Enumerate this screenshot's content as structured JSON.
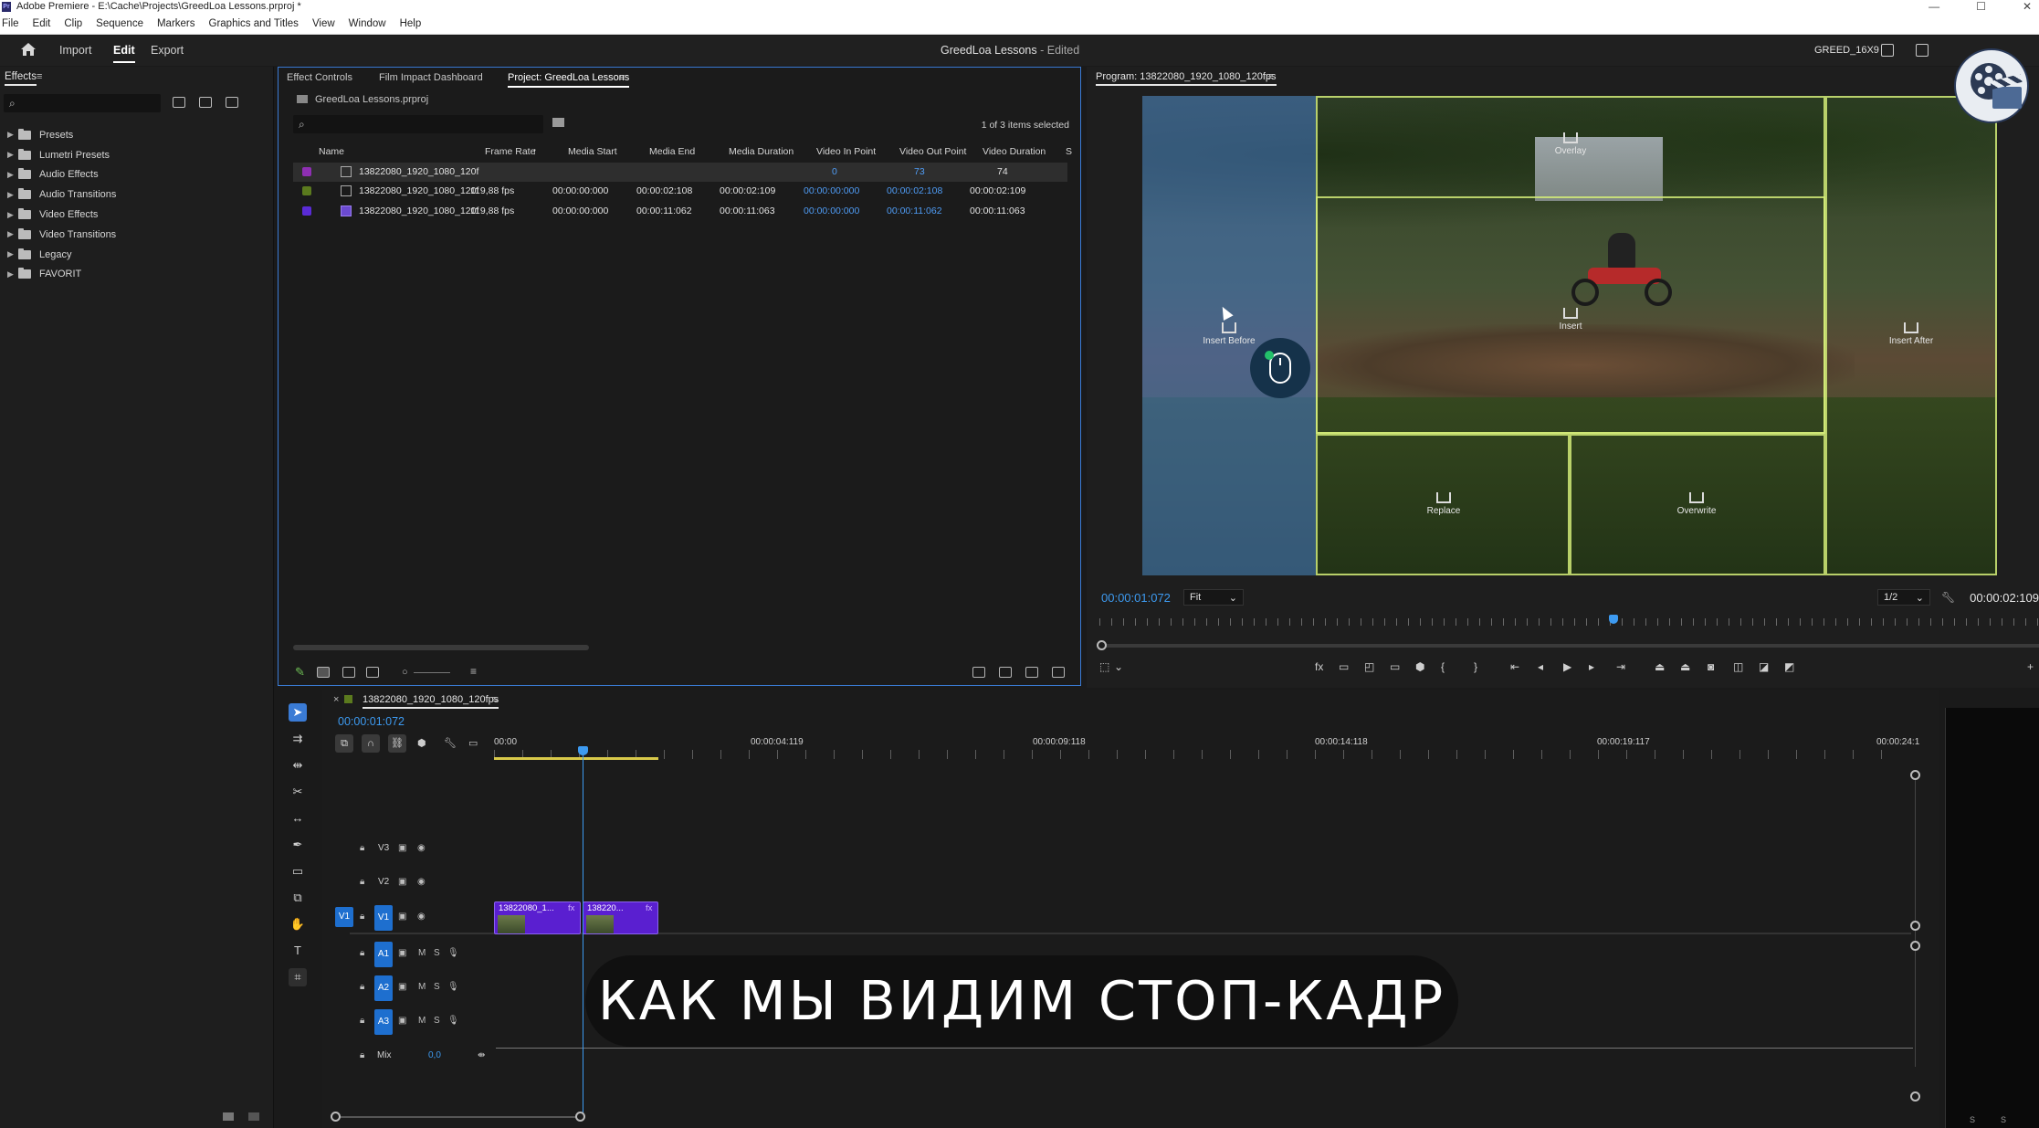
{
  "window": {
    "title": "Adobe Premiere - E:\\Cache\\Projects\\GreedLoa Lessons.prproj *",
    "logo_text": "Pr",
    "controls": [
      "—",
      "☐",
      "✕"
    ]
  },
  "menu": [
    "File",
    "Edit",
    "Clip",
    "Sequence",
    "Markers",
    "Graphics and Titles",
    "View",
    "Window",
    "Help"
  ],
  "header": {
    "tabs": [
      {
        "label": "Import",
        "active": false
      },
      {
        "label": "Edit",
        "active": true
      },
      {
        "label": "Export",
        "active": false
      }
    ],
    "project_name": "GreedLoa Lessons",
    "project_status": " - Edited",
    "workspace": "GREED_16X9"
  },
  "effects_panel": {
    "title": "Effects",
    "menu_icon": "≡",
    "search_placeholder": "",
    "items": [
      "Presets",
      "Lumetri Presets",
      "Audio Effects",
      "Audio Transitions",
      "Video Effects",
      "Video Transitions",
      "Legacy",
      "FAVORIT"
    ]
  },
  "project_panel": {
    "tabs": [
      {
        "label": "Effect Controls",
        "active": false
      },
      {
        "label": "Film Impact Dashboard",
        "active": false
      },
      {
        "label": "Project: GreedLoa Lessons",
        "active": true
      }
    ],
    "tab_menu_icon": "≡",
    "project_file": "GreedLoa Lessons.prproj",
    "search_placeholder": "",
    "selection_status": "1 of 3 items selected",
    "columns": [
      "Name",
      "Frame Rate",
      "Media Start",
      "Media End",
      "Media Duration",
      "Video In Point",
      "Video Out Point",
      "Video Duration",
      "S"
    ],
    "sort_indicator": "↑",
    "rows": [
      {
        "color": "#8e2fb3",
        "name": "13822080_1920_1080_120f",
        "frame_rate": "",
        "media_start": "",
        "media_end": "",
        "media_duration": "",
        "video_in": "0",
        "video_out": "73",
        "video_duration": "74",
        "highlighted": true
      },
      {
        "color": "#5b7a1e",
        "name": "13822080_1920_1080_120f",
        "frame_rate": "119,88 fps",
        "media_start": "00:00:00:000",
        "media_end": "00:00:02:108",
        "media_duration": "00:00:02:109",
        "video_in": "00:00:00:000",
        "video_out": "00:00:02:108",
        "video_duration": "00:00:02:109",
        "highlighted": false
      },
      {
        "color": "#5a2bd6",
        "name": "13822080_1920_1080_120f",
        "frame_rate": "119,88 fps",
        "media_start": "00:00:00:000",
        "media_end": "00:00:11:062",
        "media_duration": "00:00:11:063",
        "video_in": "00:00:00:000",
        "video_out": "00:00:11:062",
        "video_duration": "00:00:11:063",
        "highlighted": false
      }
    ]
  },
  "program_monitor": {
    "title": "Program: 13822080_1920_1080_120fps",
    "menu_icon": "≡",
    "timecode": "00:00:01:072",
    "zoom": "Fit",
    "resolution": "1/2",
    "duration": "00:00:02:109",
    "drop_zones": {
      "overlay": "Overlay",
      "insert_before": "Insert Before",
      "insert": "Insert",
      "insert_after": "Insert After",
      "replace": "Replace",
      "overwrite": "Overwrite"
    }
  },
  "timeline": {
    "sequence_name": "13822080_1920_1080_120fps",
    "menu_icon": "≡",
    "close_icon": "×",
    "timecode": "00:00:01:072",
    "ruler_labels": [
      "00:00",
      "00:00:04:119",
      "00:00:09:118",
      "00:00:14:118",
      "00:00:19:117",
      "00:00:24:1"
    ],
    "video_tracks": [
      {
        "name": "V3",
        "source": ""
      },
      {
        "name": "V2",
        "source": ""
      },
      {
        "name": "V1",
        "source": "V1"
      }
    ],
    "audio_tracks": [
      "A1",
      "A2",
      "A3"
    ],
    "mute_label": "M",
    "solo_label": "S",
    "mix": {
      "label": "Mix",
      "value": "0,0"
    },
    "clips": [
      {
        "name": "13822080_1...",
        "fx": "fx"
      },
      {
        "name": "138220...",
        "fx": "fx"
      }
    ]
  },
  "meter": {
    "labels": [
      "S",
      "S"
    ]
  },
  "subtitle": "КАК МЫ ВИДИМ СТОП-КАДР"
}
